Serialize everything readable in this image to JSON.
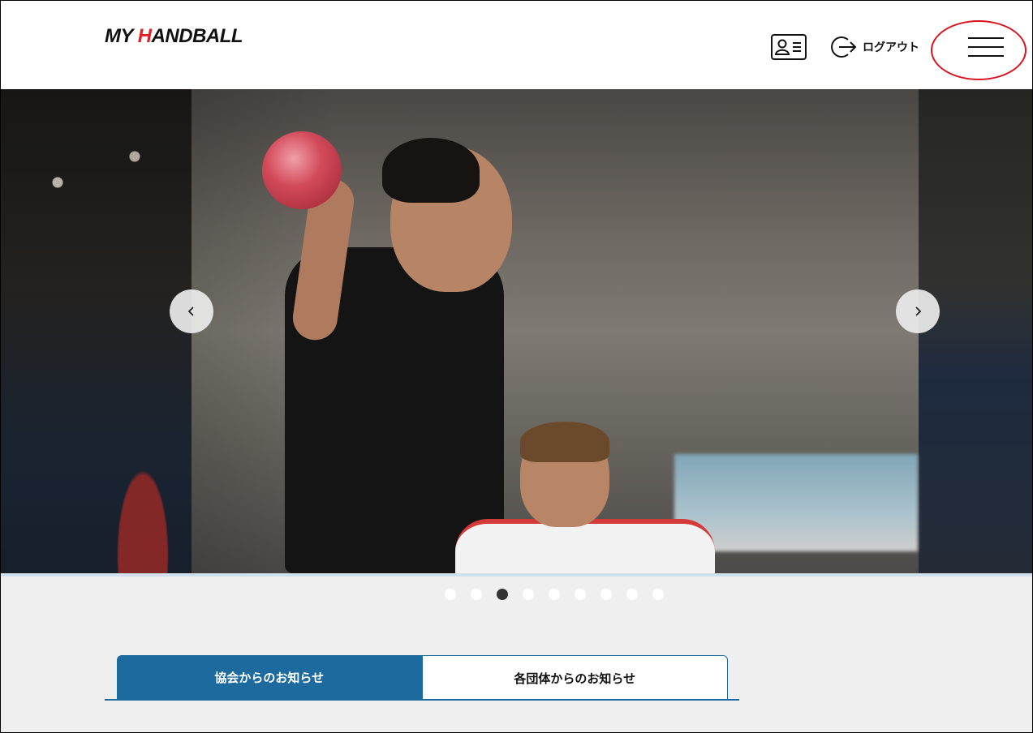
{
  "header": {
    "logo_prefix": "MY ",
    "logo_accent": "H",
    "logo_suffix": "ANDBALL",
    "logout_label": "ログアウト",
    "accent_color": "#e0232b",
    "icons": {
      "member_card": "member-card-icon",
      "logout": "logout-arrow-icon",
      "menu": "hamburger-menu-icon"
    }
  },
  "carousel": {
    "prev_icon": "chevron-left-icon",
    "next_icon": "chevron-right-icon",
    "slide_count": 9,
    "active_index": 2
  },
  "tabs": [
    {
      "label": "協会からのお知らせ",
      "active": true
    },
    {
      "label": "各団体からのお知らせ",
      "active": false
    }
  ],
  "colors": {
    "tab_active_bg": "#1d6a9f",
    "annotation_ring": "#d8121f",
    "page_bg": "#efefef"
  }
}
